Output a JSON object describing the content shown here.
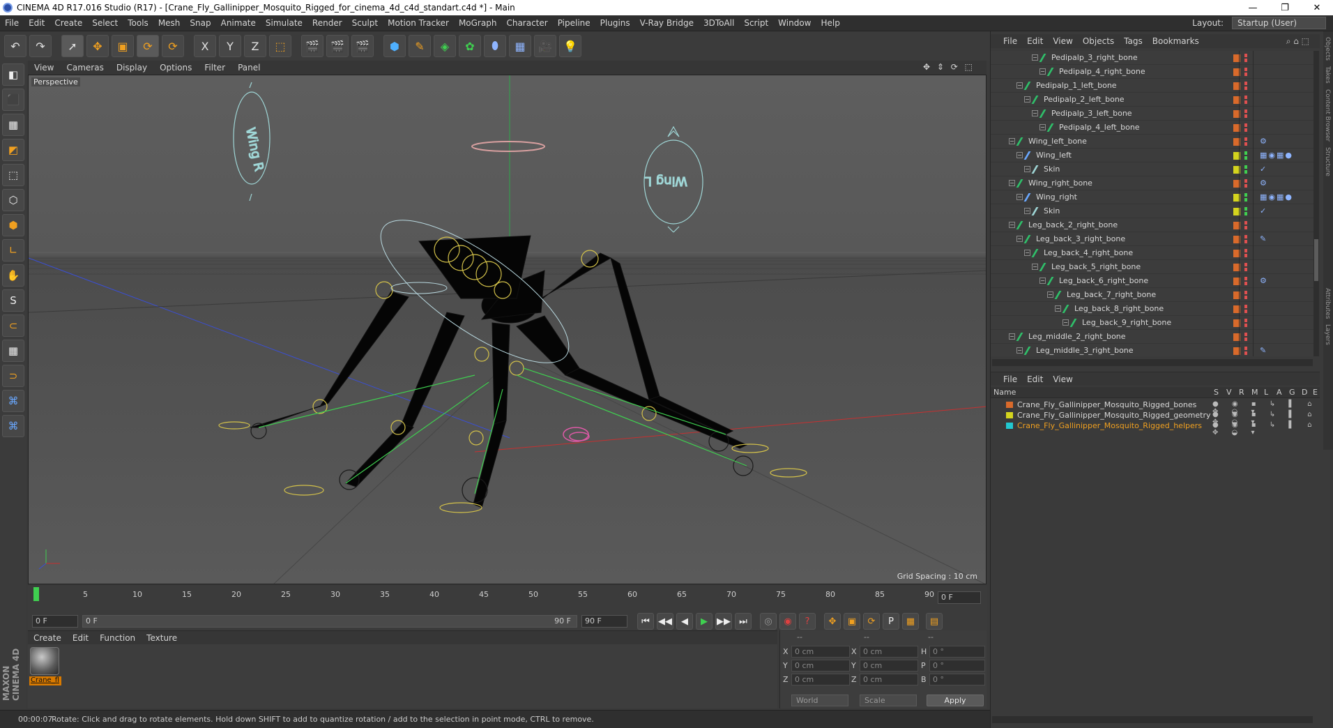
{
  "window": {
    "title": "CINEMA 4D R17.016 Studio (R17) - [Crane_Fly_Gallinipper_Mosquito_Rigged_for_cinema_4d_c4d_standart.c4d *] - Main",
    "minimize": "—",
    "restore": "❐",
    "close": "✕"
  },
  "menu": [
    "File",
    "Edit",
    "Create",
    "Select",
    "Tools",
    "Mesh",
    "Snap",
    "Animate",
    "Simulate",
    "Render",
    "Sculpt",
    "Motion Tracker",
    "MoGraph",
    "Character",
    "Pipeline",
    "Plugins",
    "V-Ray Bridge",
    "3DToAll",
    "Script",
    "Window",
    "Help"
  ],
  "layout": {
    "label": "Layout:",
    "value": "Startup (User)"
  },
  "toolbar": {
    "undo": "↶",
    "redo": "↷",
    "select": "➚",
    "move": "✥",
    "scale": "▣",
    "rotate": "⟳",
    "recent": "⟳",
    "x_axis": "X",
    "y_axis": "Y",
    "z_axis": "Z",
    "coord": "⬚",
    "render_view": "🎬",
    "render_pic": "🎬",
    "render_settings": "🎬",
    "cube": "⬢",
    "pen": "✎",
    "subdiv": "◈",
    "array": "✿",
    "deformer": "⬮",
    "floor": "▦",
    "camera": "🎥",
    "light": "💡"
  },
  "left_tools": [
    "◧",
    "⬛",
    "▦",
    "◩",
    "⬚",
    "⬡",
    "⬢",
    "∟",
    "✋",
    "S",
    "⊂",
    "▦",
    "⊃",
    "⌘",
    "⌘"
  ],
  "brand": "MAXON CINEMA 4D",
  "viewport": {
    "menu": [
      "View",
      "Cameras",
      "Display",
      "Options",
      "Filter",
      "Panel"
    ],
    "nav": "✥ ⇕ ⟳ ⬚",
    "label": "Perspective",
    "grid_spacing": "Grid Spacing : 10 cm",
    "wing_r_text": "Wing R",
    "wing_l_text": "Wing L"
  },
  "timeline": {
    "ticks": [
      "0",
      "5",
      "10",
      "15",
      "20",
      "25",
      "30",
      "35",
      "40",
      "45",
      "50",
      "55",
      "60",
      "65",
      "70",
      "75",
      "80",
      "85",
      "90"
    ],
    "frame_end": "0 F"
  },
  "transport": {
    "start_frame": "0 F",
    "range_start": "0 F",
    "range_end": "90 F",
    "end_frame": "90 F",
    "buttons": [
      "⏮",
      "◀◀",
      "◀",
      "▶",
      "▶▶",
      "⏭"
    ]
  },
  "material": {
    "menu": [
      "Create",
      "Edit",
      "Function",
      "Texture"
    ],
    "name": "Crane_fl"
  },
  "coords": {
    "headers": [
      "--",
      "--",
      "--"
    ],
    "rows": [
      {
        "a": "X",
        "av": "0 cm",
        "b": "X",
        "bv": "0 cm",
        "c": "H",
        "cv": "0 °"
      },
      {
        "a": "Y",
        "av": "0 cm",
        "b": "Y",
        "bv": "0 cm",
        "c": "P",
        "cv": "0 °"
      },
      {
        "a": "Z",
        "av": "0 cm",
        "b": "Z",
        "bv": "0 cm",
        "c": "B",
        "cv": "0 °"
      }
    ],
    "world": "World",
    "scale": "Scale",
    "apply": "Apply"
  },
  "status": {
    "time": "00:00:07",
    "message": "Rotate: Click and drag to rotate elements. Hold down SHIFT to add to quantize rotation / add to the selection in point mode, CTRL to remove."
  },
  "object_manager": {
    "menu": [
      "File",
      "Edit",
      "View",
      "Objects",
      "Tags",
      "Bookmarks"
    ],
    "rows": [
      {
        "name": "Pedipalp_3_right_bone",
        "indent": 5,
        "type": "bone",
        "color": "o",
        "dots": "r",
        "tags": ""
      },
      {
        "name": "Pedipalp_4_right_bone",
        "indent": 6,
        "type": "bone",
        "color": "o",
        "dots": "r",
        "tags": ""
      },
      {
        "name": "Pedipalp_1_left_bone",
        "indent": 3,
        "type": "bone",
        "color": "o",
        "dots": "r",
        "tags": ""
      },
      {
        "name": "Pedipalp_2_left_bone",
        "indent": 4,
        "type": "bone",
        "color": "o",
        "dots": "r",
        "tags": ""
      },
      {
        "name": "Pedipalp_3_left_bone",
        "indent": 5,
        "type": "bone",
        "color": "o",
        "dots": "r",
        "tags": ""
      },
      {
        "name": "Pedipalp_4_left_bone",
        "indent": 6,
        "type": "bone",
        "color": "o",
        "dots": "r",
        "tags": ""
      },
      {
        "name": "Wing_left_bone",
        "indent": 2,
        "type": "bone",
        "color": "o",
        "dots": "r",
        "tags": "⚙"
      },
      {
        "name": "Wing_left",
        "indent": 3,
        "type": "mesh",
        "color": "y",
        "dots": "g",
        "tags": "▦◉▦●"
      },
      {
        "name": "Skin",
        "indent": 4,
        "type": "skin",
        "color": "y",
        "dots": "g",
        "tags": "✓"
      },
      {
        "name": "Wing_right_bone",
        "indent": 2,
        "type": "bone",
        "color": "o",
        "dots": "r",
        "tags": "⚙"
      },
      {
        "name": "Wing_right",
        "indent": 3,
        "type": "mesh",
        "color": "y",
        "dots": "g",
        "tags": "▦◉▦●"
      },
      {
        "name": "Skin",
        "indent": 4,
        "type": "skin",
        "color": "y",
        "dots": "g",
        "tags": "✓"
      },
      {
        "name": "Leg_back_2_right_bone",
        "indent": 2,
        "type": "bone",
        "color": "o",
        "dots": "r",
        "tags": ""
      },
      {
        "name": "Leg_back_3_right_bone",
        "indent": 3,
        "type": "bone",
        "color": "o",
        "dots": "r",
        "tags": "✎"
      },
      {
        "name": "Leg_back_4_right_bone",
        "indent": 4,
        "type": "bone",
        "color": "o",
        "dots": "r",
        "tags": ""
      },
      {
        "name": "Leg_back_5_right_bone",
        "indent": 5,
        "type": "bone",
        "color": "o",
        "dots": "r",
        "tags": ""
      },
      {
        "name": "Leg_back_6_right_bone",
        "indent": 6,
        "type": "bone",
        "color": "o",
        "dots": "r",
        "tags": "⚙"
      },
      {
        "name": "Leg_back_7_right_bone",
        "indent": 7,
        "type": "bone",
        "color": "o",
        "dots": "r",
        "tags": ""
      },
      {
        "name": "Leg_back_8_right_bone",
        "indent": 8,
        "type": "bone",
        "color": "o",
        "dots": "r",
        "tags": ""
      },
      {
        "name": "Leg_back_9_right_bone",
        "indent": 9,
        "type": "bone",
        "color": "o",
        "dots": "r",
        "tags": ""
      },
      {
        "name": "Leg_middle_2_right_bone",
        "indent": 2,
        "type": "bone",
        "color": "o",
        "dots": "r",
        "tags": ""
      },
      {
        "name": "Leg_middle_3_right_bone",
        "indent": 3,
        "type": "bone",
        "color": "o",
        "dots": "r",
        "tags": "✎"
      }
    ]
  },
  "layer_manager": {
    "menu": [
      "File",
      "Edit",
      "View"
    ],
    "headers": [
      "Name",
      "S",
      "V",
      "R",
      "M",
      "L",
      "A",
      "G",
      "D",
      "E"
    ],
    "layers": [
      {
        "name": "Crane_Fly_Gallinipper_Mosquito_Rigged_bones",
        "color": "#d96a2b",
        "text_color": "#d8d8d8"
      },
      {
        "name": "Crane_Fly_Gallinipper_Mosquito_Rigged_geometry",
        "color": "#d4d41e",
        "text_color": "#d8d8d8"
      },
      {
        "name": "Crane_Fly_Gallinipper_Mosquito_Rigged_helpers",
        "color": "#22c8d0",
        "text_color": "#f0a020"
      }
    ],
    "icons": "● ◉ ▪ ↳ ▌ ⌂ ✥ ◒ ▾"
  },
  "side_tabs": [
    "Objects",
    "Takes",
    "Content Browser",
    "Structure"
  ],
  "side_tabs_bottom": [
    "Attributes",
    "Layers"
  ]
}
